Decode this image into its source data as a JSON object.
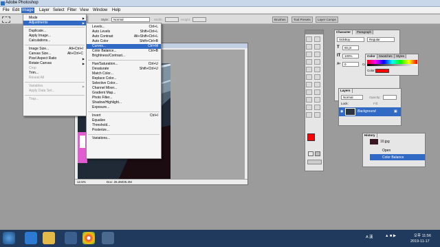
{
  "window": {
    "title": "Adobe Photoshop"
  },
  "menubar": {
    "items": [
      "File",
      "Edit",
      "Image",
      "Layer",
      "Select",
      "Filter",
      "View",
      "Window",
      "Help"
    ],
    "open_index": 2
  },
  "options": {
    "style_label": "Style:",
    "style_value": "Normal",
    "width_label": "Width:",
    "height_label": "Height:"
  },
  "workspace_tabs": [
    "Brushes",
    "Tool Presets",
    "Layer Comps"
  ],
  "image_menu": [
    {
      "label": "Mode",
      "submenu": true
    },
    {
      "label": "Adjustments",
      "submenu": true,
      "highlight": true
    },
    {
      "sep": true
    },
    {
      "label": "Duplicate..."
    },
    {
      "label": "Apply Image..."
    },
    {
      "label": "Calculations..."
    },
    {
      "sep": true
    },
    {
      "label": "Image Size...",
      "shortcut": "Alt+Ctrl+I"
    },
    {
      "label": "Canvas Size...",
      "shortcut": "Alt+Ctrl+C"
    },
    {
      "label": "Pixel Aspect Ratio",
      "submenu": true
    },
    {
      "label": "Rotate Canvas",
      "submenu": true
    },
    {
      "label": "Crop",
      "disabled": true
    },
    {
      "label": "Trim..."
    },
    {
      "label": "Reveal All",
      "disabled": true
    },
    {
      "sep": true
    },
    {
      "label": "Variables",
      "submenu": true,
      "disabled": true
    },
    {
      "label": "Apply Data Set...",
      "disabled": true
    },
    {
      "sep": true
    },
    {
      "label": "Trap...",
      "disabled": true
    }
  ],
  "adjust_menu": [
    {
      "label": "Levels...",
      "shortcut": "Ctrl+L"
    },
    {
      "label": "Auto Levels",
      "shortcut": "Shift+Ctrl+L"
    },
    {
      "label": "Auto Contrast",
      "shortcut": "Alt+Shift+Ctrl+L"
    },
    {
      "label": "Auto Color",
      "shortcut": "Shift+Ctrl+B"
    },
    {
      "label": "Curves...",
      "shortcut": "Ctrl+M",
      "highlight": true
    },
    {
      "label": "Color Balance...",
      "shortcut": "Ctrl+B"
    },
    {
      "label": "Brightness/Contrast..."
    },
    {
      "sep": true
    },
    {
      "label": "Hue/Saturation...",
      "shortcut": "Ctrl+U"
    },
    {
      "label": "Desaturate",
      "shortcut": "Shift+Ctrl+U"
    },
    {
      "label": "Match Color..."
    },
    {
      "label": "Replace Color..."
    },
    {
      "label": "Selective Color..."
    },
    {
      "label": "Channel Mixer..."
    },
    {
      "label": "Gradient Map..."
    },
    {
      "label": "Photo Filter..."
    },
    {
      "label": "Shadow/Highlight..."
    },
    {
      "label": "Exposure..."
    },
    {
      "sep": true
    },
    {
      "label": "Invert",
      "shortcut": "Ctrl+I"
    },
    {
      "label": "Equalize"
    },
    {
      "label": "Threshold..."
    },
    {
      "label": "Posterize..."
    },
    {
      "sep": true
    },
    {
      "label": "Variations..."
    }
  ],
  "document": {
    "zoom": "12.5%",
    "doc_size": "Doc: 26.2M/25.2M"
  },
  "character_panel": {
    "tabs": [
      "Character",
      "Paragraph"
    ],
    "font": "SickBoy",
    "style": "Regular",
    "size": "65 pt",
    "vscale": "100%",
    "tracking": "0",
    "color_label": "Color:"
  },
  "color_panel": {
    "tabs": [
      "Color",
      "Swatches",
      "Styles"
    ]
  },
  "layers_panel": {
    "tab": "Layers",
    "blend": "Normal",
    "opacity_label": "Opacity:",
    "lock_label": "Lock:",
    "fill_label": "Fill:",
    "layer": "Background"
  },
  "history_panel": {
    "tab": "History",
    "snapshot": "10.jpg",
    "items": [
      "Open",
      "Color Balance"
    ]
  },
  "taskbar": {
    "ime": "A 漢",
    "time": "오후 11:56",
    "date": "2019-11-17"
  },
  "colors": {
    "highlight": "#316ac5",
    "foreground": "#ff0000",
    "taskbar": "#1f3a5c"
  }
}
